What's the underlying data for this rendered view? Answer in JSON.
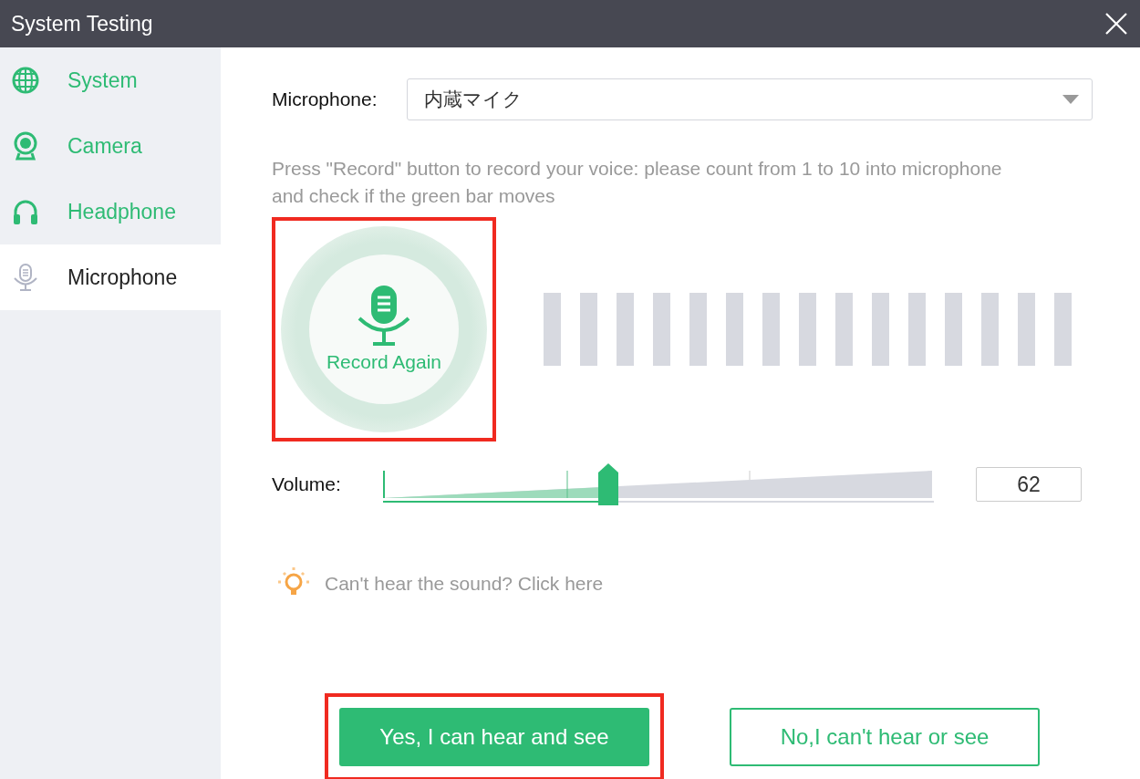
{
  "window": {
    "title": "System Testing"
  },
  "sidebar": {
    "items": [
      {
        "label": "System",
        "kind": "globe",
        "selected": false
      },
      {
        "label": "Camera",
        "kind": "camera",
        "selected": false
      },
      {
        "label": "Headphone",
        "kind": "headphone",
        "selected": false
      },
      {
        "label": "Microphone",
        "kind": "mic",
        "selected": true
      }
    ]
  },
  "microphone": {
    "label": "Microphone:",
    "value": "内蔵マイク"
  },
  "instructions": "Press \"Record\" button to record your voice: please count from 1 to 10 into microphone and check if the green bar moves",
  "record_button": {
    "label": "Record Again",
    "highlighted": true
  },
  "volume": {
    "label": "Volume:",
    "level": 0.41,
    "reading": "62"
  },
  "help_link": "Can't hear the sound? Click here",
  "buttons": [
    {
      "label": "Yes, I can hear and see",
      "kind": "primary",
      "highlighted": true
    },
    {
      "label": "No,I can't hear or see",
      "kind": "outline",
      "highlighted": false
    }
  ]
}
